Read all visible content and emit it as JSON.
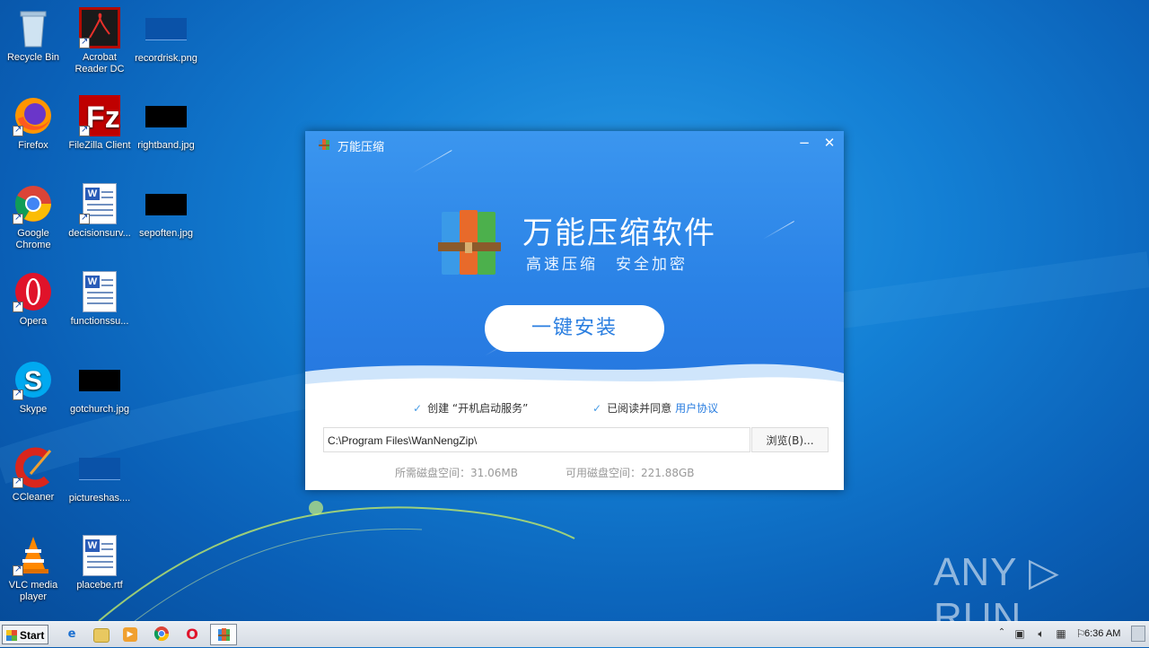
{
  "desktop": {
    "icons": [
      {
        "label": "Recycle Bin"
      },
      {
        "label": "Acrobat Reader DC"
      },
      {
        "label": "recordrisk.png"
      },
      {
        "label": "Firefox"
      },
      {
        "label": "FileZilla Client"
      },
      {
        "label": "rightband.jpg"
      },
      {
        "label": "Google Chrome"
      },
      {
        "label": "decisionsurv..."
      },
      {
        "label": "sepoften.jpg"
      },
      {
        "label": "Opera"
      },
      {
        "label": "functionssu..."
      },
      {
        "label": "Skype"
      },
      {
        "label": "gotchurch.jpg"
      },
      {
        "label": "CCleaner"
      },
      {
        "label": "pictureshas...."
      },
      {
        "label": "VLC media player"
      },
      {
        "label": "placebe.rtf"
      }
    ]
  },
  "installer": {
    "window_title": "万能压缩",
    "minimize": "−",
    "close": "✕",
    "heading": "万能压缩软件",
    "subheading": "高速压缩　安全加密",
    "install_button": "一键安装",
    "option_startup": "创建 “开机启动服务”",
    "option_agree": "已阅读并同意",
    "agreement_link": "用户协议",
    "install_path": "C:\\Program Files\\WanNengZip\\",
    "browse_button": "浏览(B)...",
    "disk_required": "所需磁盘空间：31.06MB",
    "disk_available": "可用磁盘空间：221.88GB"
  },
  "watermark": "ANY ▷ RUN",
  "taskbar": {
    "start_label": "Start",
    "clock": "6:36 AM"
  },
  "colors": {
    "accent": "#2a7ee0",
    "hero_top": "#3b96ef"
  }
}
